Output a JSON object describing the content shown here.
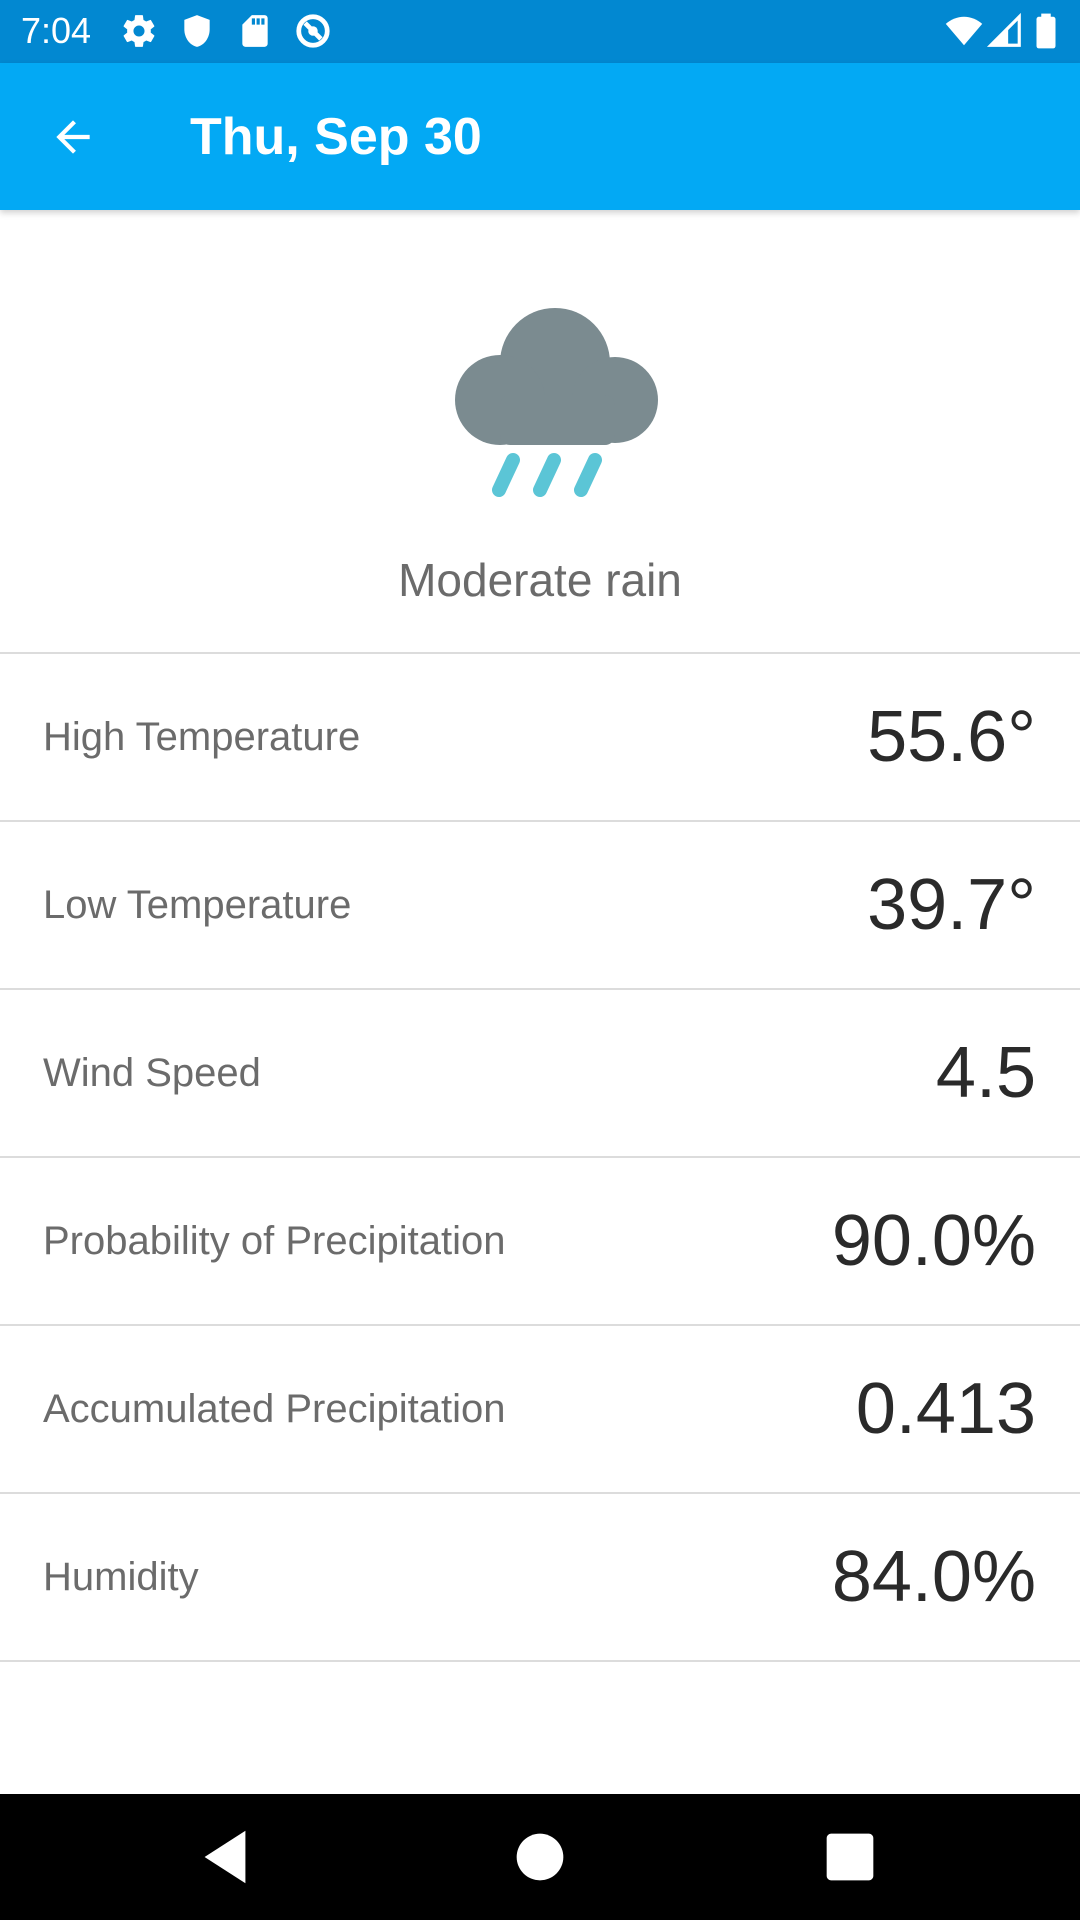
{
  "status_bar": {
    "time": "7:04",
    "left_icons": [
      "settings-gear-icon",
      "shield-icon",
      "sd-card-icon",
      "no-disturb-icon"
    ],
    "right_icons": [
      "wifi-icon",
      "cell-signal-icon",
      "battery-icon"
    ]
  },
  "app_bar": {
    "back_icon": "arrow-back-icon",
    "title": "Thu, Sep 30",
    "background_color": "#03a9f4"
  },
  "weather": {
    "icon": "cloud-rain-icon",
    "condition": "Moderate rain",
    "cloud_color": "#7b8b90",
    "rain_color": "#5bc5d6"
  },
  "details": [
    {
      "label": "High Temperature",
      "value": "55.6°"
    },
    {
      "label": "Low Temperature",
      "value": "39.7°"
    },
    {
      "label": "Wind Speed",
      "value": "4.5"
    },
    {
      "label": "Probability of Precipitation",
      "value": "90.0%"
    },
    {
      "label": "Accumulated Precipitation",
      "value": "0.413"
    },
    {
      "label": "Humidity",
      "value": "84.0%"
    }
  ],
  "nav_bar": {
    "icons": [
      "nav-back-icon",
      "nav-home-icon",
      "nav-recents-icon"
    ]
  }
}
